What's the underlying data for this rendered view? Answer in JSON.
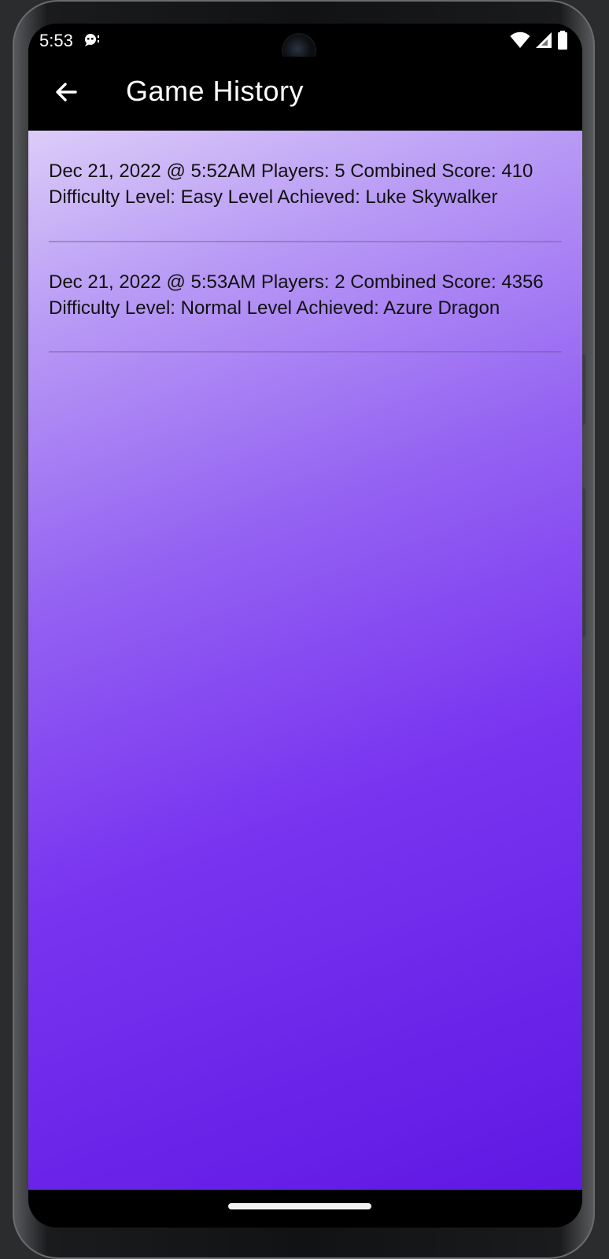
{
  "status_bar": {
    "time": "5:53",
    "icons": [
      "notification-icon",
      "wifi-icon",
      "cell-signal-icon",
      "battery-icon"
    ]
  },
  "app_bar": {
    "back_icon": "arrow-back-icon",
    "title": "Game History"
  },
  "history": [
    {
      "text": "Dec 21, 2022 @ 5:52AM  Players: 5 Combined Score: 410 Difficulty Level: Easy Level Achieved: Luke Skywalker"
    },
    {
      "text": "Dec 21, 2022 @ 5:53AM  Players: 2 Combined Score: 4356 Difficulty Level: Normal Level Achieved: Azure Dragon"
    }
  ],
  "colors": {
    "app_bar": "#000000",
    "background_top": "#dcccf8",
    "background_bottom": "#5f18e3",
    "divider": "#8a78b8"
  }
}
